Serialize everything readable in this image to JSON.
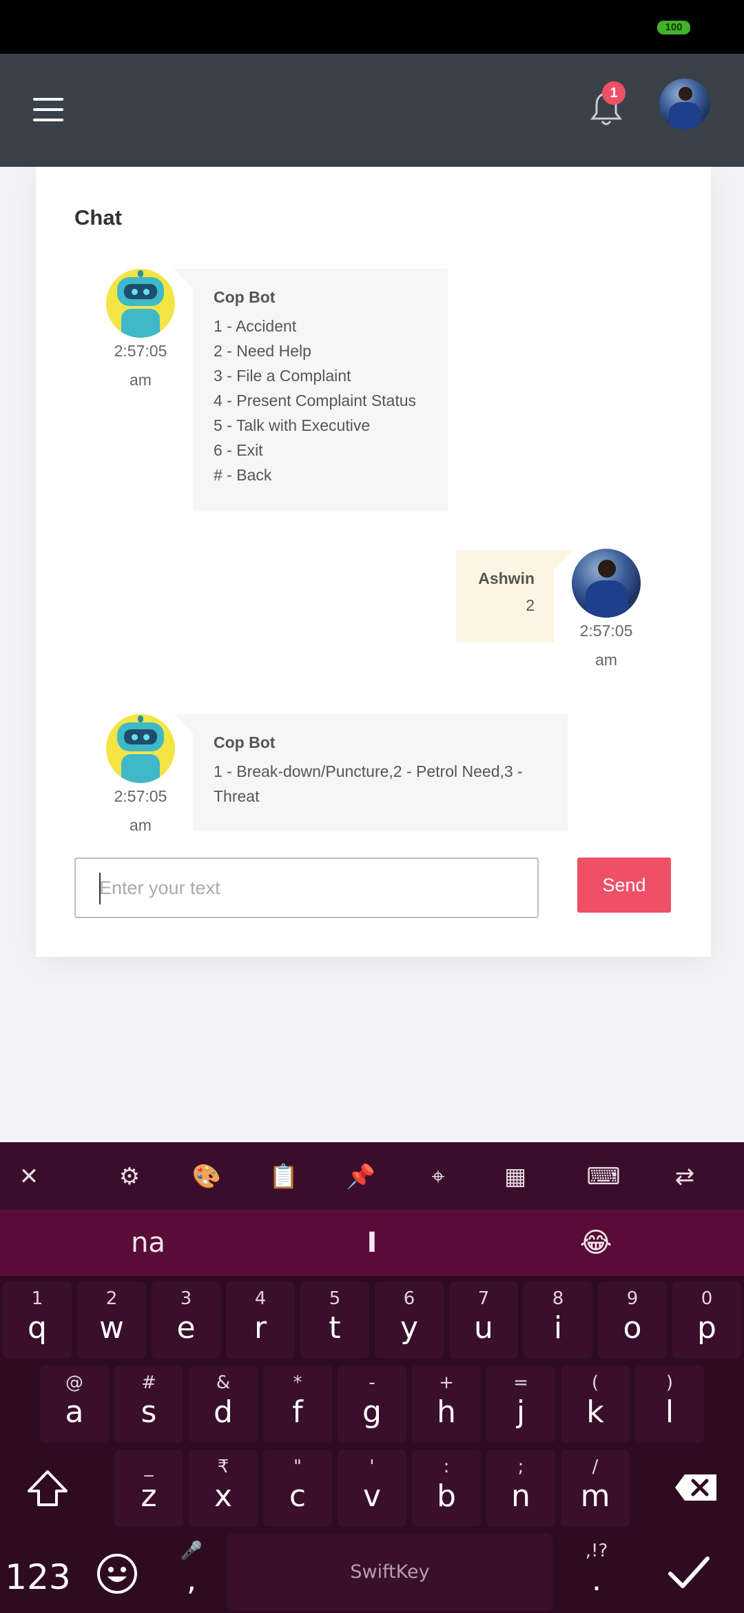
{
  "status_bar": {
    "battery": "100"
  },
  "header": {
    "menu_icon": "hamburger-icon",
    "notification_icon": "bell-icon",
    "notification_count": "1"
  },
  "chat": {
    "title": "Chat",
    "messages": [
      {
        "sender": "Cop Bot",
        "time": "2:57:05",
        "meridiem": "am",
        "lines": [
          "1 - Accident",
          "2 - Need Help",
          "3 - File a Complaint",
          "4 - Present Complaint Status",
          "5 - Talk with Executive",
          "6 - Exit",
          "# - Back"
        ]
      },
      {
        "sender": "Ashwin",
        "time": "2:57:05",
        "meridiem": "am",
        "lines": [
          "2"
        ]
      },
      {
        "sender": "Cop Bot",
        "time": "2:57:05",
        "meridiem": "am",
        "lines": [
          "1 - Break-down/Puncture,2 - Petrol Need,3 -",
          "Threat"
        ]
      }
    ],
    "input_placeholder": "Enter your text",
    "send_label": "Send"
  },
  "keyboard": {
    "toolbar_icons": [
      "close-icon",
      "gear-icon",
      "palette-icon",
      "clipboard-icon",
      "pin-icon",
      "location-icon",
      "calendar-icon",
      "keyboard-icon",
      "translate-icon"
    ],
    "suggestions": [
      "na",
      "I",
      "😂"
    ],
    "row1": [
      [
        "1",
        "q"
      ],
      [
        "2",
        "w"
      ],
      [
        "3",
        "e"
      ],
      [
        "4",
        "r"
      ],
      [
        "5",
        "t"
      ],
      [
        "6",
        "y"
      ],
      [
        "7",
        "u"
      ],
      [
        "8",
        "i"
      ],
      [
        "9",
        "o"
      ],
      [
        "0",
        "p"
      ]
    ],
    "row2": [
      [
        "@",
        "a"
      ],
      [
        "#",
        "s"
      ],
      [
        "&",
        "d"
      ],
      [
        "*",
        "f"
      ],
      [
        "-",
        "g"
      ],
      [
        "+",
        "h"
      ],
      [
        "=",
        "j"
      ],
      [
        "(",
        "k"
      ],
      [
        ")",
        "l"
      ]
    ],
    "row3": [
      [
        "_",
        "z"
      ],
      [
        "₹",
        "x"
      ],
      [
        "\"",
        "c"
      ],
      [
        "'",
        "v"
      ],
      [
        ":",
        "b"
      ],
      [
        ";",
        "n"
      ],
      [
        "/",
        "m"
      ]
    ],
    "numbers_label": "123",
    "comma_label": ",",
    "space_label": "SwiftKey",
    "period_label": ".",
    "period_hint": ",!?"
  }
}
